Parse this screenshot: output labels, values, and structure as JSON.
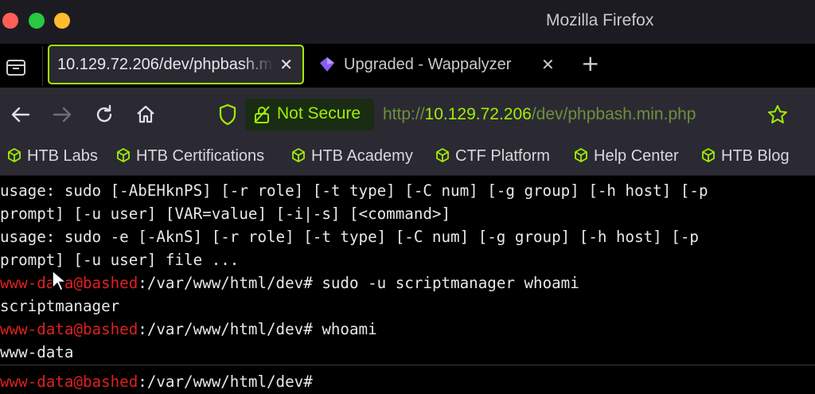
{
  "window": {
    "title": "Mozilla Firefox"
  },
  "tabs": [
    {
      "label": "10.129.72.206/dev/phpbash.min.php",
      "close": "✕",
      "active": true
    },
    {
      "label": "Upgraded - Wappalyzer",
      "close": "✕",
      "active": false
    }
  ],
  "new_tab": "+",
  "nav": {
    "security_label": "Not Secure",
    "url_scheme": "http://",
    "url_host": "10.129.72.206",
    "url_path": "/dev/phpbash.min.php"
  },
  "bookmarks": [
    "HTB Labs",
    "HTB Certifications",
    "HTB Academy",
    "CTF Platform",
    "Help Center",
    "HTB Blog"
  ],
  "terminal": {
    "lines": [
      {
        "text": "usage: sudo [-AbEHknPS] [-r role] [-t type] [-C num] [-g group] [-h host] [-p"
      },
      {
        "text": "prompt] [-u user] [VAR=value] [-i|-s] [<command>]"
      },
      {
        "text": "usage: sudo -e [-AknS] [-r role] [-t type] [-C num] [-g group] [-h host] [-p"
      },
      {
        "text": "prompt] [-u user] file ..."
      },
      {
        "user": "www-data@bashed",
        "path": ":/var/www/html/dev# ",
        "cmd": "sudo -u scriptmanager whoami"
      },
      {
        "text": "scriptmanager"
      },
      {
        "user": "www-data@bashed",
        "path": ":/var/www/html/dev# ",
        "cmd": "whoami"
      },
      {
        "text": "www-data"
      }
    ],
    "prompt": {
      "user": "www-data@bashed",
      "path": ":/var/www/html/dev#"
    }
  },
  "colors": {
    "accent": "#9fef00",
    "prompt_user": "#e02020",
    "terminal_bg": "#000000",
    "chrome_bg": "#2b2a33"
  }
}
